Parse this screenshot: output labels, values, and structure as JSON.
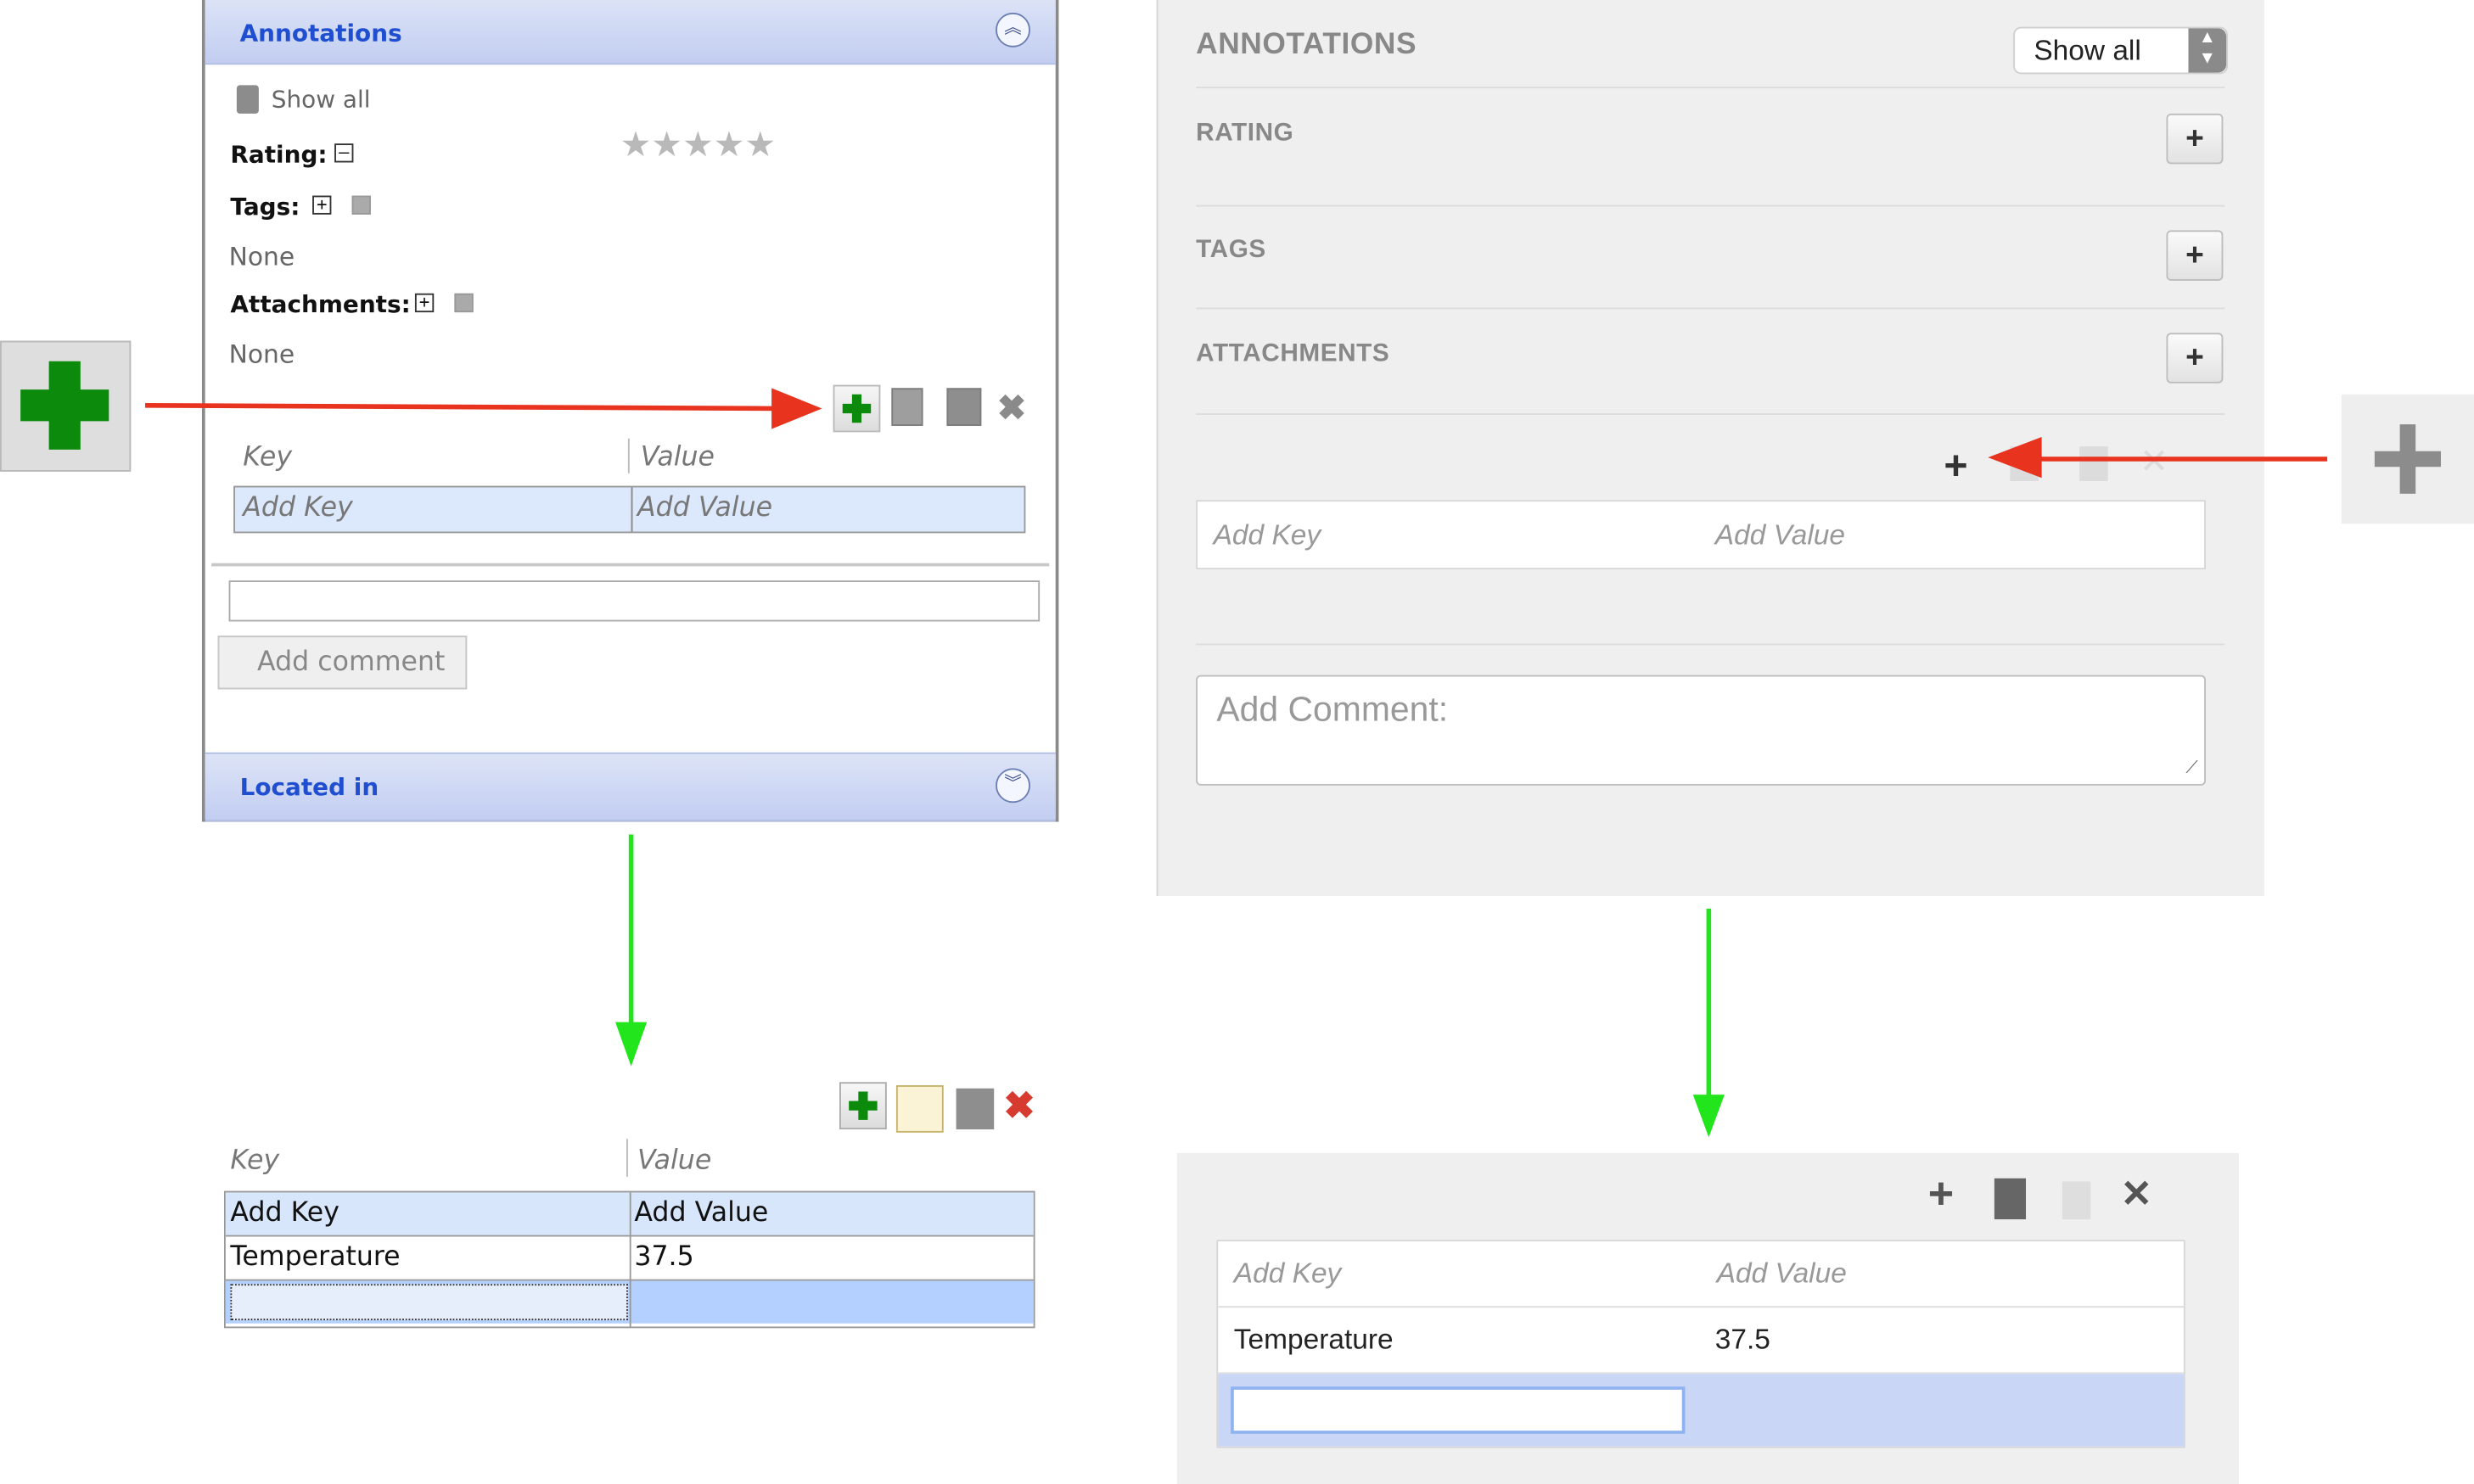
{
  "old_ui": {
    "annotations_header": "Annotations",
    "show_all": "Show all",
    "rating_label": "Rating:",
    "rating_value": 0,
    "rating_max": 5,
    "tags_label": "Tags:",
    "tags_value": "None",
    "attachments_label": "Attachments:",
    "attachments_value": "None",
    "key_header": "Key",
    "value_header": "Value",
    "add_key_placeholder": "Add Key",
    "add_value_placeholder": "Add Value",
    "comment_button": "Add comment",
    "located_in_header": "Located in",
    "after": {
      "key_header": "Key",
      "value_header": "Value",
      "header_row": {
        "key": "Add Key",
        "value": "Add Value"
      },
      "row": {
        "key": "Temperature",
        "value": "37.5"
      }
    }
  },
  "new_ui": {
    "annotations_header": "ANNOTATIONS",
    "show_all": "Show all",
    "rating_label": "RATING",
    "tags_label": "TAGS",
    "attachments_label": "ATTACHMENTS",
    "add_key_placeholder": "Add Key",
    "add_value_placeholder": "Add Value",
    "comment_placeholder": "Add Comment:",
    "after": {
      "header_row": {
        "key": "Add Key",
        "value": "Add Value"
      },
      "row": {
        "key": "Temperature",
        "value": "37.5"
      }
    }
  },
  "icons": {
    "add": "green-plus-icon",
    "copy": "copy-icon",
    "paste": "paste-icon",
    "delete": "delete-icon",
    "web_add": "grey-plus-icon"
  },
  "colors": {
    "annotation_arrow": "#e8331f",
    "flow_arrow": "#22e51c",
    "plus_green": "#0b8a0b",
    "old_header_blue": "#1f4fd0",
    "selected_row_blue": "#b4d0ff",
    "web_selected_row": "#cad6f5"
  }
}
